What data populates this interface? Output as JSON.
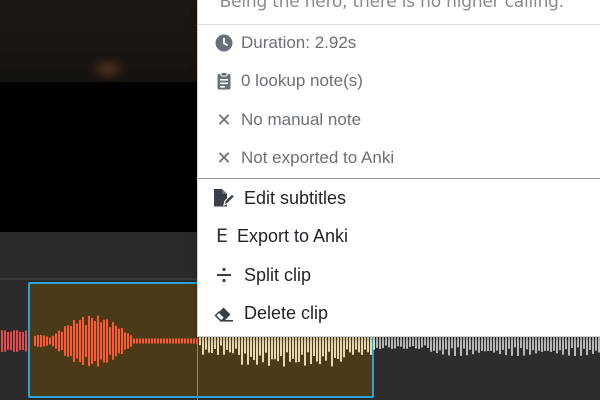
{
  "menu": {
    "quote": "\"Being the hero, there is no higher calling.\"",
    "info": [
      {
        "icon": "clock-icon",
        "text": "Duration: 2.92s"
      },
      {
        "icon": "clipboard-icon",
        "text": "0 lookup note(s)"
      },
      {
        "icon": "x-icon",
        "text": "No manual note"
      },
      {
        "icon": "x-icon",
        "text": "Not exported to Anki"
      }
    ],
    "actions": [
      {
        "icon": "file-edit-icon",
        "text": "Edit subtitles"
      },
      {
        "icon": "e-letter-icon",
        "text": "Export to Anki",
        "glyph": "E"
      },
      {
        "icon": "divide-icon",
        "text": "Split clip"
      },
      {
        "icon": "eraser-icon",
        "text": "Delete clip"
      }
    ]
  },
  "colors": {
    "selection_border": "#2aa3d8",
    "selected_clip_bg": "#4b3a17",
    "waveform_played": "#ff5a2e",
    "waveform_unplayed": "#e8d9b0",
    "waveform_other": "#b9b9b9",
    "waveform_left": "#e5484d"
  }
}
